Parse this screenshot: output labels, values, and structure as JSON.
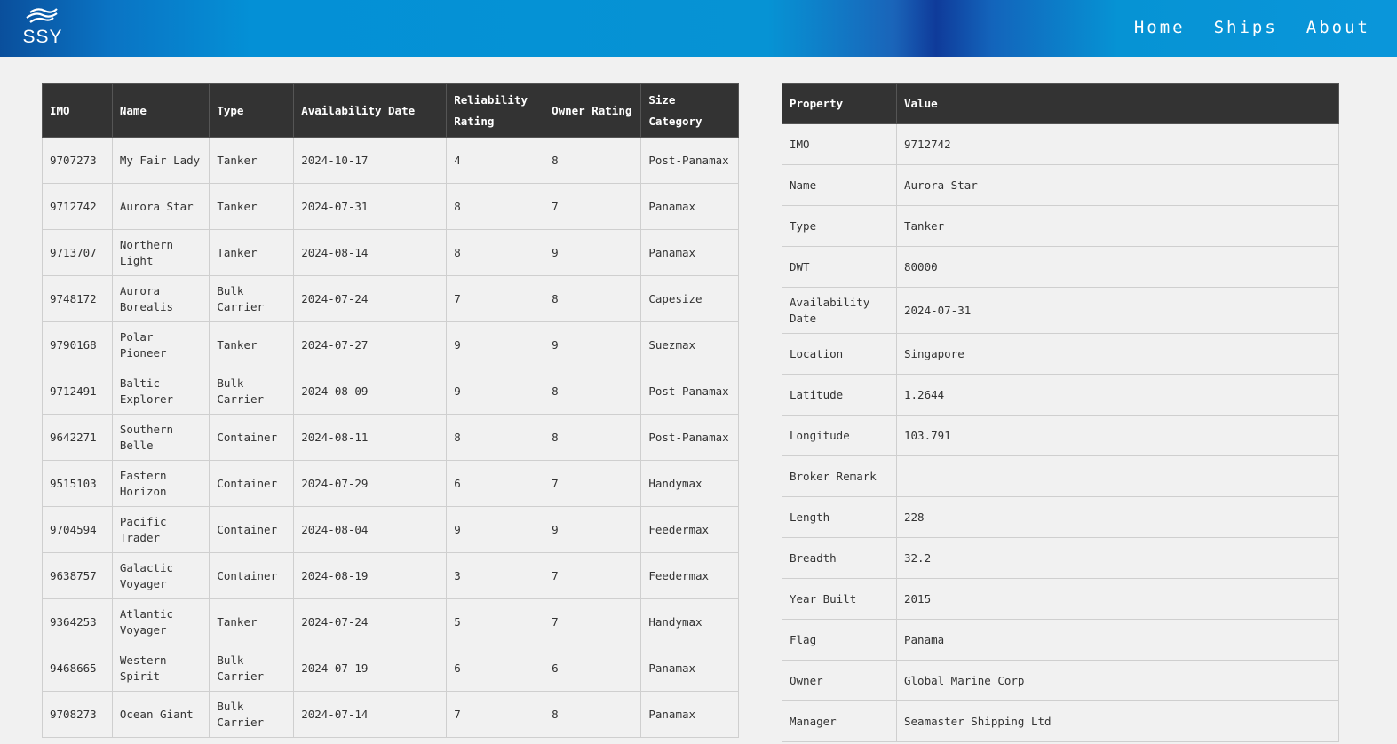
{
  "header": {
    "logo_text": "SSY",
    "nav": [
      {
        "label": "Home"
      },
      {
        "label": "Ships"
      },
      {
        "label": "About"
      }
    ]
  },
  "ships_table": {
    "columns": [
      "IMO",
      "Name",
      "Type",
      "Availability Date",
      "Reliability Rating",
      "Owner Rating",
      "Size Category"
    ],
    "rows": [
      [
        "9707273",
        "My Fair Lady",
        "Tanker",
        "2024-10-17",
        "4",
        "8",
        "Post-Panamax"
      ],
      [
        "9712742",
        "Aurora Star",
        "Tanker",
        "2024-07-31",
        "8",
        "7",
        "Panamax"
      ],
      [
        "9713707",
        "Northern Light",
        "Tanker",
        "2024-08-14",
        "8",
        "9",
        "Panamax"
      ],
      [
        "9748172",
        "Aurora Borealis",
        "Bulk Carrier",
        "2024-07-24",
        "7",
        "8",
        "Capesize"
      ],
      [
        "9790168",
        "Polar Pioneer",
        "Tanker",
        "2024-07-27",
        "9",
        "9",
        "Suezmax"
      ],
      [
        "9712491",
        "Baltic Explorer",
        "Bulk Carrier",
        "2024-08-09",
        "9",
        "8",
        "Post-Panamax"
      ],
      [
        "9642271",
        "Southern Belle",
        "Container",
        "2024-08-11",
        "8",
        "8",
        "Post-Panamax"
      ],
      [
        "9515103",
        "Eastern Horizon",
        "Container",
        "2024-07-29",
        "6",
        "7",
        "Handymax"
      ],
      [
        "9704594",
        "Pacific Trader",
        "Container",
        "2024-08-04",
        "9",
        "9",
        "Feedermax"
      ],
      [
        "9638757",
        "Galactic Voyager",
        "Container",
        "2024-08-19",
        "3",
        "7",
        "Feedermax"
      ],
      [
        "9364253",
        "Atlantic Voyager",
        "Tanker",
        "2024-07-24",
        "5",
        "7",
        "Handymax"
      ],
      [
        "9468665",
        "Western Spirit",
        "Bulk Carrier",
        "2024-07-19",
        "6",
        "6",
        "Panamax"
      ],
      [
        "9708273",
        "Ocean Giant",
        "Bulk Carrier",
        "2024-07-14",
        "7",
        "8",
        "Panamax"
      ]
    ]
  },
  "details_table": {
    "columns": [
      "Property",
      "Value"
    ],
    "rows": [
      [
        "IMO",
        "9712742"
      ],
      [
        "Name",
        "Aurora Star"
      ],
      [
        "Type",
        "Tanker"
      ],
      [
        "DWT",
        "80000"
      ],
      [
        "Availability Date",
        "2024-07-31"
      ],
      [
        "Location",
        "Singapore"
      ],
      [
        "Latitude",
        "1.2644"
      ],
      [
        "Longitude",
        "103.791"
      ],
      [
        "Broker Remark",
        ""
      ],
      [
        "Length",
        "228"
      ],
      [
        "Breadth",
        "32.2"
      ],
      [
        "Year Built",
        "2015"
      ],
      [
        "Flag",
        "Panama"
      ],
      [
        "Owner",
        "Global Marine Corp"
      ],
      [
        "Manager",
        "Seamaster Shipping Ltd"
      ]
    ]
  }
}
